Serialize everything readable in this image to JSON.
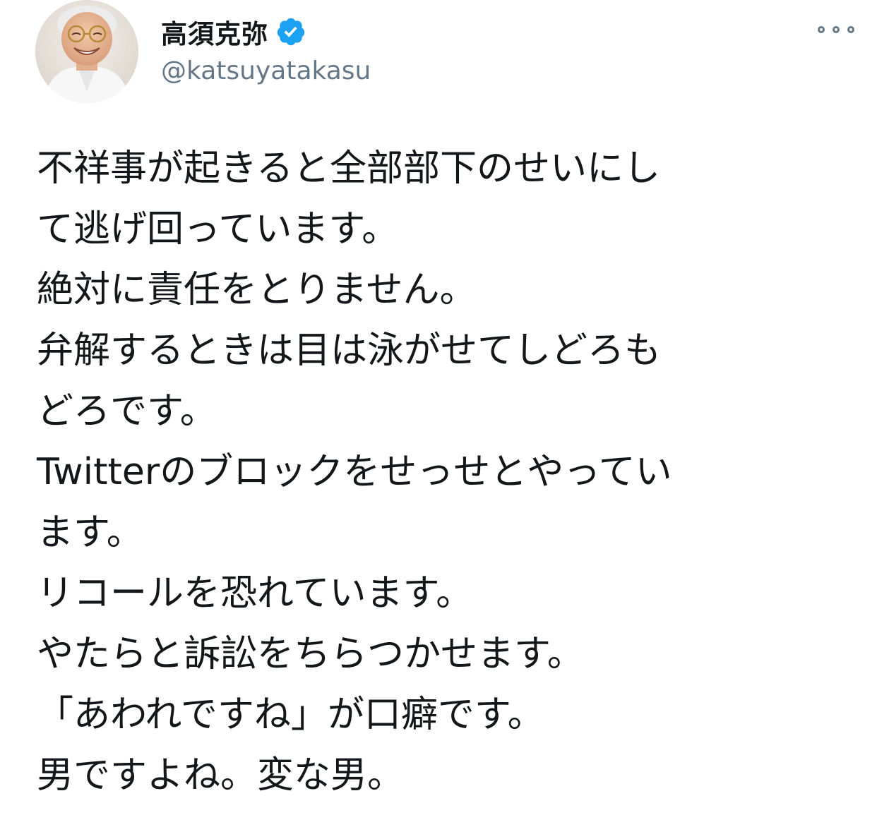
{
  "tweet": {
    "author": {
      "display_name": "高須克弥",
      "handle": "@katsuyatakasu",
      "verified": true,
      "verified_badge_color": "#1da1f2"
    },
    "more_icon": "more-horizontal-icon",
    "text_lines": [
      "不祥事が起きると全部部下のせいにし",
      "て逃げ回っています。",
      "絶対に責任をとりません。",
      "弁解するときは目は泳がせてしどろも",
      "どろです。",
      "Twitterのブロックをせっせとやってい",
      "ます。",
      "リコールを恐れています。",
      "やたらと訴訟をちらつかせます。",
      "「あわれですね」が口癖です。",
      "男ですよね。変な男。"
    ]
  },
  "colors": {
    "text": "#14171a",
    "secondary_text": "#657786",
    "background": "#ffffff"
  }
}
